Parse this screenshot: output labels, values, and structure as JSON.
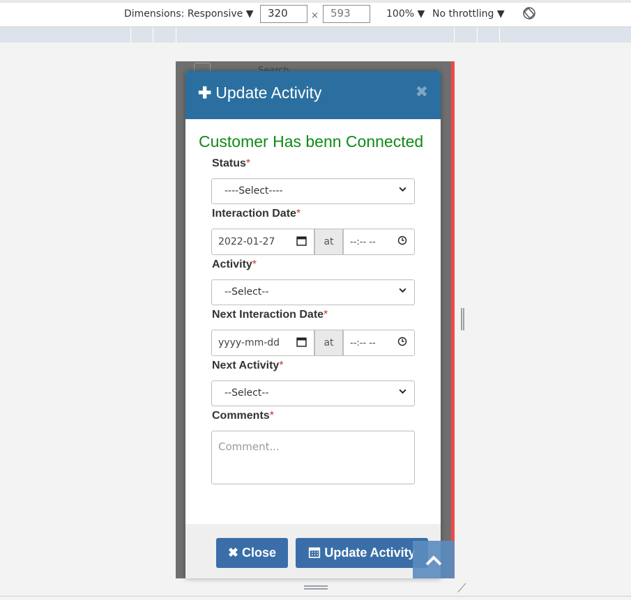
{
  "devtools": {
    "dimensions_label": "Dimensions: Responsive ▼",
    "width": "320",
    "times": "×",
    "height": "593",
    "zoom": "100% ▼",
    "throttling": "No throttling ▼",
    "rotate_icon": "rotate-icon"
  },
  "background": {
    "search_text": "Search"
  },
  "modal": {
    "title": "Update Activity",
    "plus_icon": "✚",
    "close_icon": "✖",
    "banner": "Customer Has benn Connected",
    "required_mark": "*",
    "fields": {
      "status_label": "Status",
      "status_value": "----Select----",
      "interaction_date_label": "Interaction Date",
      "interaction_date_value": "2022-01-27",
      "at_label": "at",
      "time_value": "--:-- --",
      "activity_label": "Activity",
      "activity_value": "--Select--",
      "next_interaction_date_label": "Next Interaction Date",
      "next_interaction_date_placeholder": "yyyy-mm-dd",
      "next_activity_label": "Next Activity",
      "next_activity_value": "--Select--",
      "comments_label": "Comments",
      "comments_placeholder": "Comment..."
    },
    "footer": {
      "close_label": "Close",
      "update_label": "Update Activity"
    }
  },
  "colors": {
    "header": "#2a6fa0",
    "banner": "#0e8a16",
    "button": "#3a6ea8",
    "required": "#c0392b"
  }
}
